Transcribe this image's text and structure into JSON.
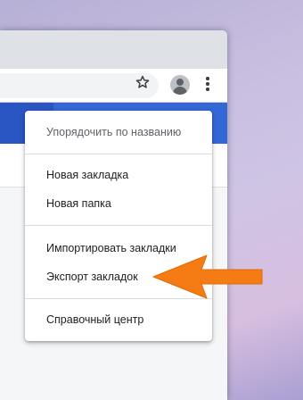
{
  "browser": {
    "icons": {
      "bookmark": "star-icon",
      "profile": "avatar-icon",
      "menu": "more-vertical-icon"
    }
  },
  "bookmark_menu": {
    "sort_label": "Упорядочить по названию",
    "new_bookmark_label": "Новая закладка",
    "new_folder_label": "Новая папка",
    "import_label": "Импортировать закладки",
    "export_label": "Экспорт закладок",
    "help_label": "Справочный центр"
  },
  "annotation": {
    "arrow_color": "#f57c14",
    "arrow_icon": "arrow-left-icon"
  },
  "colors": {
    "header_blue": "#3367d6",
    "tab_strip": "#dee1e6"
  }
}
